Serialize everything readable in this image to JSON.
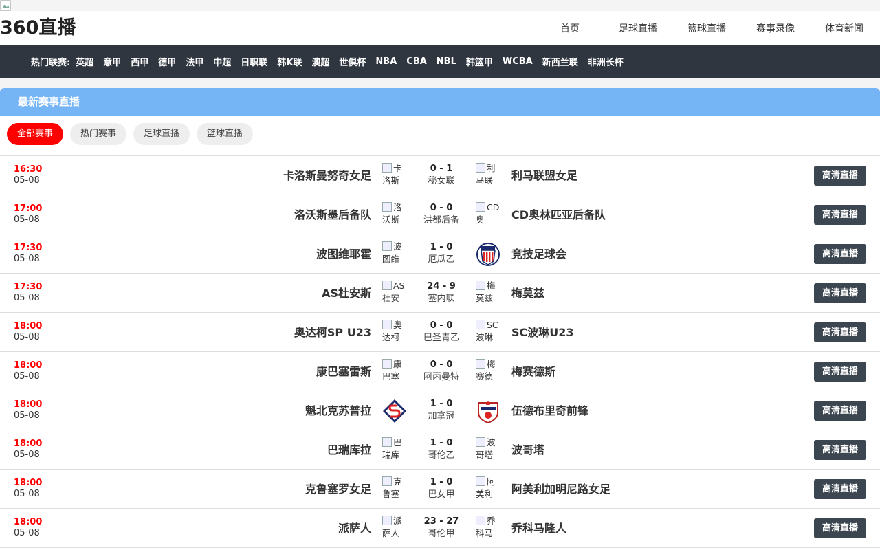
{
  "site": {
    "logo": "360直播"
  },
  "nav": [
    "首页",
    "足球直播",
    "篮球直播",
    "赛事录像",
    "体育新闻"
  ],
  "league_bar": {
    "label": "热门联赛:",
    "items": [
      "英超",
      "意甲",
      "西甲",
      "德甲",
      "法甲",
      "中超",
      "日职联",
      "韩K联",
      "澳超",
      "世俱杯",
      "NBA",
      "CBA",
      "NBL",
      "韩篮甲",
      "WCBA",
      "新西兰联",
      "非洲长杯"
    ]
  },
  "panel": {
    "title": "最新赛事直播",
    "tabs": [
      "全部赛事",
      "热门赛事",
      "足球直播",
      "篮球直播"
    ],
    "active_tab": "全部赛事",
    "live_button_label": "高清直播"
  },
  "matches": [
    {
      "time": "16:30",
      "date": "05-08",
      "home": "卡洛斯曼努奇女足",
      "home_logo_alt": "卡洛斯",
      "score": "0 - 1",
      "league": "秘女联",
      "away": "利马联盟女足",
      "away_logo_alt": "利马联"
    },
    {
      "time": "17:00",
      "date": "05-08",
      "home": "洛沃斯墨后备队",
      "home_logo_alt": "洛沃斯",
      "score": "0 - 0",
      "league": "洪都后备",
      "away": "CD奥林匹亚后备队",
      "away_logo_alt": "CD奥"
    },
    {
      "time": "17:30",
      "date": "05-08",
      "home": "波图维耶霍",
      "home_logo_alt": "波图维",
      "score": "1 - 0",
      "league": "厄瓜乙",
      "away": "竞技足球会",
      "away_logo_alt": ""
    },
    {
      "time": "17:30",
      "date": "05-08",
      "home": "AS杜安斯",
      "home_logo_alt": "AS杜安",
      "score": "24 - 9",
      "league": "塞内联",
      "away": "梅莫兹",
      "away_logo_alt": "梅莫兹"
    },
    {
      "time": "18:00",
      "date": "05-08",
      "home": "奥达柯SP U23",
      "home_logo_alt": "奥达柯",
      "score": "0 - 0",
      "league": "巴圣青乙",
      "away": "SC波琳U23",
      "away_logo_alt": "SC波琳"
    },
    {
      "time": "18:00",
      "date": "05-08",
      "home": "康巴塞雷斯",
      "home_logo_alt": "康巴塞",
      "score": "0 - 0",
      "league": "阿丙曼特",
      "away": "梅赛德斯",
      "away_logo_alt": "梅赛德"
    },
    {
      "time": "18:00",
      "date": "05-08",
      "home": "魁北克苏普拉",
      "home_logo_alt": "",
      "score": "1 - 0",
      "league": "加拿冠",
      "away": "伍德布里奇前锋",
      "away_logo_alt": ""
    },
    {
      "time": "18:00",
      "date": "05-08",
      "home": "巴瑞库拉",
      "home_logo_alt": "巴瑞库",
      "score": "1 - 0",
      "league": "哥伦乙",
      "away": "波哥塔",
      "away_logo_alt": "波哥塔"
    },
    {
      "time": "18:00",
      "date": "05-08",
      "home": "克鲁塞罗女足",
      "home_logo_alt": "克鲁塞",
      "score": "1 - 0",
      "league": "巴女甲",
      "away": "阿美利加明尼路女足",
      "away_logo_alt": "阿美利"
    },
    {
      "time": "18:00",
      "date": "05-08",
      "home": "派萨人",
      "home_logo_alt": "派萨人",
      "score": "23 - 27",
      "league": "哥伦甲",
      "away": "乔科马隆人",
      "away_logo_alt": "乔科马"
    }
  ]
}
